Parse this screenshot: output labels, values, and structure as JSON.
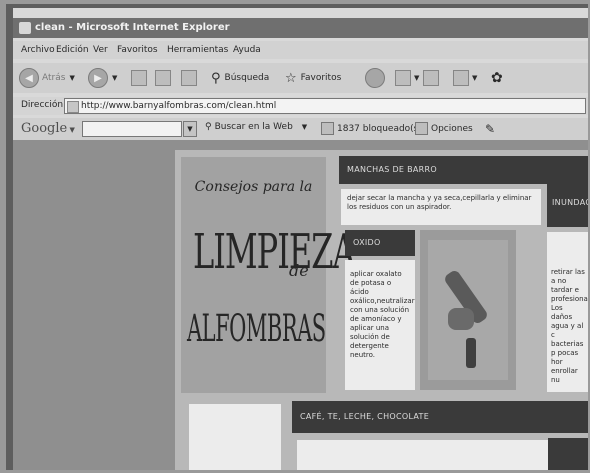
{
  "browser": {
    "title": "clean - Microsoft Internet Explorer",
    "menu": [
      "Archivo",
      "Edición",
      "Ver",
      "Favoritos",
      "Herramientas",
      "Ayuda"
    ],
    "toolbar": {
      "back_label": "Atrás",
      "search_label": "Búsqueda",
      "favorites_label": "Favoritos"
    },
    "address": {
      "label": "Dirección",
      "url": "http://www.barnyalfombras.com/clean.html"
    },
    "google_bar": {
      "logo": "Google",
      "search_web_label": "Buscar en la Web",
      "blocked_label": "1837 bloqueado(s)",
      "options_label": "Opciones"
    }
  },
  "site": {
    "logo": {
      "line1": "Consejos para la",
      "line2": "LIMPIEZA",
      "line3": "de",
      "line4": "ALFOMBRAS"
    },
    "sections": {
      "manchas_barro": {
        "header": "MANCHAS DE BARRO",
        "text": "dejar secar la mancha y ya seca,cepillarla y eliminar los residuos con un aspirador."
      },
      "oxido": {
        "header": "OXIDO",
        "text": "aplicar oxalato de potasa o ácido oxálico,neutralizar con una solución de amoníaco y aplicar una solución de detergente neutro."
      },
      "inundacion": {
        "header": "INUNDAC",
        "text": "retirar las a no tardar e profesiona Los daños agua y al c bacterias p pocas hor enrollar nu"
      },
      "cafe": {
        "header": "CAFÉ, TE, LECHE, CHOCOLATE"
      }
    }
  }
}
